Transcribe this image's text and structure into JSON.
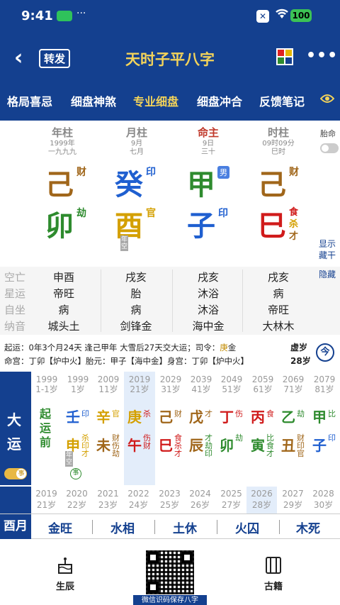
{
  "status": {
    "time": "9:41",
    "dots": "···",
    "x_icon": "✕",
    "wifi_icon": "wifi-icon",
    "battery": "100"
  },
  "nav": {
    "back": "‹",
    "forward": "转发",
    "title": "天时子平八字",
    "more": "•••"
  },
  "tabs": [
    {
      "label": "格局喜忌",
      "active": false
    },
    {
      "label": "细盘神煞",
      "active": false
    },
    {
      "label": "专业细盘",
      "active": true
    },
    {
      "label": "细盘冲合",
      "active": false
    },
    {
      "label": "反馈笔记",
      "active": false
    }
  ],
  "pillars": [
    {
      "name": "年柱",
      "date": "1999年",
      "extra": "一九九九",
      "stem": "己",
      "stem_tag": "财",
      "branch": "卯",
      "branch_tags": [
        "劫"
      ]
    },
    {
      "name": "月柱",
      "date": "9月",
      "extra": "七月",
      "stem": "癸",
      "stem_tag": "印",
      "branch": "酉",
      "branch_tags": [
        "官"
      ],
      "kong": "年空"
    },
    {
      "name": "命主",
      "date": "9日",
      "extra": "三十",
      "stem": "甲",
      "stem_tag": "男",
      "branch": "子",
      "branch_tags": [
        "印"
      ]
    },
    {
      "name": "时柱",
      "date": "09时09分",
      "extra": "巳时",
      "stem": "己",
      "stem_tag": "财",
      "branch": "巳",
      "branch_tags": [
        "食",
        "杀",
        "才"
      ]
    }
  ],
  "side": {
    "taiming": "胎命",
    "show": "显示",
    "canggan": "藏干",
    "hide": "隐藏"
  },
  "info_rows": [
    {
      "label": "空亡",
      "values": [
        "申酉",
        "戌亥",
        "戌亥",
        "戌亥"
      ]
    },
    {
      "label": "星运",
      "values": [
        "帝旺",
        "胎",
        "沐浴",
        "病"
      ]
    },
    {
      "label": "自坐",
      "values": [
        "病",
        "病",
        "沐浴",
        "帝旺"
      ]
    },
    {
      "label": "纳音",
      "values": [
        "城头土",
        "剑锋金",
        "海中金",
        "大林木"
      ]
    }
  ],
  "yun_info": {
    "line1_a": "起运：0年3个月24天 逢己甲年 大雪后27天交大运；司令：",
    "line1_gold": "庚",
    "line1_b": "金",
    "line2": "命宫：丁卯【炉中火】胎元：甲子【海中金】身宫：丁卯【炉中火】",
    "xusui_label": "虚岁",
    "xusui_value": "28岁",
    "today": "今"
  },
  "dayun": {
    "label1": "大",
    "label2": "运",
    "event": "事",
    "qiyun": "起运前",
    "columns": [
      {
        "year": "1999",
        "age": "1-1岁"
      },
      {
        "year": "1999",
        "age": "1岁",
        "stem": "壬",
        "stem_ten": "印",
        "branch": "申",
        "branch_ten": "杀印才",
        "kong": "年空"
      },
      {
        "year": "2009",
        "age": "11岁",
        "stem": "辛",
        "stem_ten": "官",
        "branch": "未",
        "branch_ten": "财伤劫"
      },
      {
        "year": "2019",
        "age": "21岁",
        "stem": "庚",
        "stem_ten": "杀",
        "branch": "午",
        "branch_ten": "伤财"
      },
      {
        "year": "2029",
        "age": "31岁",
        "stem": "己",
        "stem_ten": "财",
        "branch": "巳",
        "branch_ten": "食杀才"
      },
      {
        "year": "2039",
        "age": "41岁",
        "stem": "戊",
        "stem_ten": "才",
        "branch": "辰",
        "branch_ten": "才劫印"
      },
      {
        "year": "2049",
        "age": "51岁",
        "stem": "丁",
        "stem_ten": "伤",
        "branch": "卯",
        "branch_ten": "劫"
      },
      {
        "year": "2059",
        "age": "61岁",
        "stem": "丙",
        "stem_ten": "食",
        "branch": "寅",
        "branch_ten": "比食才"
      },
      {
        "year": "2069",
        "age": "71岁",
        "stem": "乙",
        "stem_ten": "劫",
        "branch": "丑",
        "branch_ten": "财印官"
      },
      {
        "year": "2079",
        "age": "81岁",
        "stem": "甲",
        "stem_ten": "比",
        "branch": "子",
        "branch_ten": "印"
      }
    ],
    "event_circle": "事"
  },
  "liunian": [
    {
      "year": "2019",
      "age": "21岁"
    },
    {
      "year": "2020",
      "age": "22岁"
    },
    {
      "year": "2021",
      "age": "23岁"
    },
    {
      "year": "2022",
      "age": "24岁"
    },
    {
      "year": "2023",
      "age": "25岁"
    },
    {
      "year": "2024",
      "age": "26岁"
    },
    {
      "year": "2025",
      "age": "27岁"
    },
    {
      "year": "2026",
      "age": "28岁"
    },
    {
      "year": "2027",
      "age": "29岁"
    },
    {
      "year": "2028",
      "age": "30岁"
    }
  ],
  "month_bar": {
    "label": "酉月",
    "items": [
      "金旺",
      "水相",
      "土休",
      "火囚",
      "木死"
    ]
  },
  "bottom": {
    "left_label": "生辰",
    "right_label": "古籍",
    "qr_caption": "微信识码保存八字"
  },
  "colors": {
    "earth": "#a0661a",
    "water": "#1f5fd0",
    "wood": "#2e8b2e",
    "fire": "#d01b1b",
    "metal": "#d4a000",
    "brand": "#14408f"
  }
}
